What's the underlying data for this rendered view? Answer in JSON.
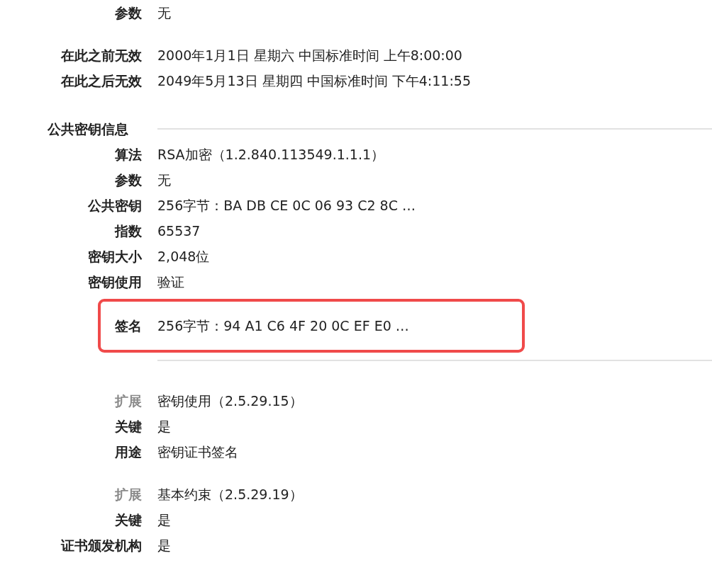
{
  "groups": [
    {
      "rows": [
        {
          "label": "参数",
          "value": "无",
          "dim": false,
          "highlighted": false
        }
      ]
    },
    {
      "rows": [
        {
          "label": "在此之前无效",
          "value": "2000年1月1日 星期六 中国标准时间 上午8:00:00",
          "dim": false,
          "highlighted": false
        },
        {
          "label": "在此之后无效",
          "value": "2049年5月13日 星期四 中国标准时间 下午4:11:55",
          "dim": false,
          "highlighted": false
        }
      ]
    },
    {
      "header": "公共密钥信息",
      "rule_after": true,
      "rows": [
        {
          "label": "算法",
          "value": "RSA加密（1.2.840.113549.1.1.1）",
          "dim": false,
          "highlighted": false
        },
        {
          "label": "参数",
          "value": "无",
          "dim": false,
          "highlighted": false
        },
        {
          "label": "公共密钥",
          "value": "256字节：BA DB CE 0C 06 93 C2 8C …",
          "dim": false,
          "highlighted": false
        },
        {
          "label": "指数",
          "value": "65537",
          "dim": false,
          "highlighted": false
        },
        {
          "label": "密钥大小",
          "value": "2,048位",
          "dim": false,
          "highlighted": false
        },
        {
          "label": "密钥使用",
          "value": "验证",
          "dim": false,
          "highlighted": false
        },
        {
          "label": "签名",
          "value": "256字节：94 A1 C6 4F 20 0C EF E0 …",
          "dim": false,
          "highlighted": true
        }
      ]
    },
    {
      "rows": [
        {
          "label": "扩展",
          "value": "密钥使用（2.5.29.15）",
          "dim": true,
          "highlighted": false
        },
        {
          "label": "关键",
          "value": "是",
          "dim": false,
          "highlighted": false
        },
        {
          "label": "用途",
          "value": "密钥证书签名",
          "dim": false,
          "highlighted": false
        }
      ]
    },
    {
      "rows": [
        {
          "label": "扩展",
          "value": "基本约束（2.5.29.19）",
          "dim": true,
          "highlighted": false
        },
        {
          "label": "关键",
          "value": "是",
          "dim": false,
          "highlighted": false
        },
        {
          "label": "证书颁发机构",
          "value": "是",
          "dim": false,
          "highlighted": false
        }
      ]
    }
  ]
}
